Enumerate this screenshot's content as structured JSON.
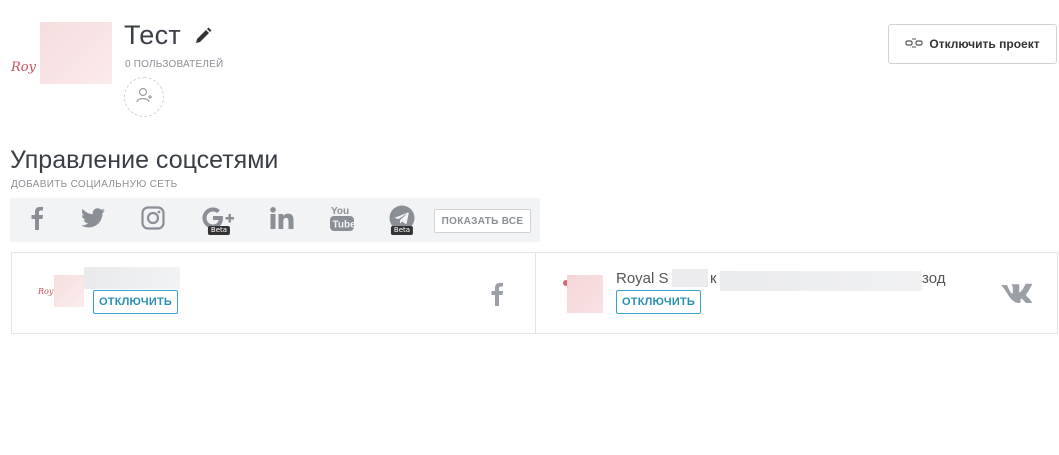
{
  "project": {
    "logo_text": "Roy",
    "title": "Тест",
    "users_count": "0 ПОЛЬЗОВАТЕЛЕЙ",
    "disable_button": "Отключить проект"
  },
  "social": {
    "section_title": "Управление соцсетями",
    "add_label": "ДОБАВИТЬ СОЦИАЛЬНУЮ СЕТЬ",
    "networks": [
      {
        "icon": "facebook-icon",
        "beta": ""
      },
      {
        "icon": "twitter-icon",
        "beta": ""
      },
      {
        "icon": "instagram-icon",
        "beta": ""
      },
      {
        "icon": "google-plus-icon",
        "beta": "Beta"
      },
      {
        "icon": "linkedin-icon",
        "beta": ""
      },
      {
        "icon": "youtube-icon",
        "beta": ""
      },
      {
        "icon": "telegram-icon",
        "beta": "Beta"
      }
    ],
    "show_all": "ПОКАЗАТЬ ВСЕ"
  },
  "connected": [
    {
      "network": "facebook",
      "logo_text": "Roy",
      "disconnect": "ОТКЛЮЧИТЬ"
    },
    {
      "network": "vk",
      "name_start": "Royal S",
      "name_mid": "к",
      "name_end": "зод",
      "disconnect": "ОТКЛЮЧИТЬ"
    }
  ],
  "colors": {
    "accent": "#2a8fb5",
    "icon_gray": "#8a8f96",
    "logo_red": "#c9515a"
  }
}
